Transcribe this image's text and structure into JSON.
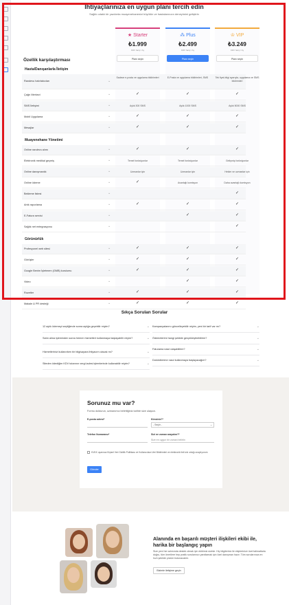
{
  "page": {
    "title": "İhtiyaçlarınıza en uygun planı tercih edin",
    "subtitle": "Sağlık odaklı bir yazılımla muayenehanenizi büyütün ve hastalarınızın deneyimini geliştirin"
  },
  "comparison": {
    "title": "Özellik karşılaştırması"
  },
  "plans": [
    {
      "name": "Starter",
      "icon": "star-icon",
      "color": "#d63f7a",
      "price": "₺1.999",
      "tag": "KDV hariç / Ay",
      "button": "Planı seçin",
      "primary": false
    },
    {
      "name": "Plus",
      "icon": "sparkle-icon",
      "color": "#3b82f6",
      "price": "₺2.499",
      "tag": "KDV hariç / Ay",
      "button": "Planı seçin",
      "primary": true
    },
    {
      "name": "VIP",
      "icon": "crown-icon",
      "color": "#f2a93b",
      "price": "₺3.249",
      "tag": "KDV hariç / Ay",
      "button": "Planı seçin",
      "primary": false
    }
  ],
  "sections": [
    {
      "title": "Hasta/Danışanlarla İletişim",
      "rows": [
        {
          "label": "Randevu hatırlatıcıları",
          "cells": [
            "Sadece e-posta ve uygulama bildirimleri",
            "E-Posta ve uygulama bildirimleri, SMS",
            "Tek fiyat-bilgi ayarıyla, uygulama ve SMS bildirimleri"
          ]
        },
        {
          "label": "Çağrı Merkezi",
          "cells": [
            "✓",
            "✓",
            "✓"
          ]
        },
        {
          "label": "SMS İletişimi",
          "cells": [
            "Aylık 300 SMS",
            "Aylık 1000 SMS",
            "Aylık 5000 SMS"
          ]
        },
        {
          "label": "Mobil Uygulama",
          "cells": [
            "✓",
            "✓",
            "✓"
          ]
        },
        {
          "label": "Mesajlar",
          "cells": [
            "✓",
            "✓",
            "✓"
          ]
        }
      ]
    },
    {
      "title": "Muayenehane Yönetimi",
      "rows": [
        {
          "label": "Online randevu alımı",
          "cells": [
            "✓",
            "✓",
            "✓"
          ]
        },
        {
          "label": "Elektronik medikal geçmiş",
          "cells": [
            "Temel fonksiyonlar",
            "Temel fonksiyonlar",
            "Gelişmiş fonksiyonlar"
          ]
        },
        {
          "label": "Online danışmanlık",
          "cells": [
            "Uzmanlar için",
            "Uzmanlar için",
            "Hekim ve uzmanlar için"
          ]
        },
        {
          "label": "Online ödeme",
          "cells": [
            "✓",
            "Avantajlı komisyon",
            "Daha avantajlı komisyon"
          ]
        },
        {
          "label": "Bekleme listesi",
          "cells": [
            "",
            "",
            "✓"
          ]
        },
        {
          "label": "Artık raporlama",
          "cells": [
            "✓",
            "✓",
            "✓"
          ]
        },
        {
          "label": "E-Fatura servisi",
          "cells": [
            "",
            "✓",
            "✓"
          ]
        },
        {
          "label": "Sağlık net entegrasyonu",
          "cells": [
            "",
            "",
            "✓"
          ]
        }
      ]
    },
    {
      "title": "Görünürlük",
      "rows": [
        {
          "label": "Profesyonel web sitesi",
          "cells": [
            "✓",
            "✓",
            "✓"
          ]
        },
        {
          "label": "Görüşler",
          "cells": [
            "✓",
            "✓",
            "✓"
          ]
        },
        {
          "label": "Google Benim İşletmem (GMB) kurulumu",
          "cells": [
            "✓",
            "✓",
            "✓"
          ]
        },
        {
          "label": "Video",
          "cells": [
            "",
            "✓",
            "✓"
          ]
        },
        {
          "label": "Rozetler",
          "cells": [
            "✓",
            "✓",
            "✓"
          ]
        },
        {
          "label": "Makale & PR desteği",
          "cells": [
            "✓",
            "✓",
            "✓"
          ]
        }
      ]
    }
  ],
  "faq": {
    "title": "Sıkça Sorulan Sorular",
    "left": [
      "12 aylık ödemeyi seçtiğimde sonra aylığa geçebilir miyim?",
      "Satın alma işleminden sonra hemen hizmetleri kullanmaya başlayabilir miyim?",
      "Hizmetlerinizi kullanırken bir bilgisayara ihtiyacım olacak mı?",
      "Siteden ödediğim KDV tutarının vergi iadesi işlemlerinde kullanabilir miyim?"
    ],
    "right": [
      "Kampanyalarımı güncelleyebilir miyim, yeni bir tarif var mı?",
      "Ödemelerimi hangi şekilde gerçekleştirebilirim?",
      "Faturama nasıl ulaşabilirim?",
      "Dokürdlerime nasıl kullanmaya başlayacağım?"
    ]
  },
  "contact": {
    "title": "Sorunuz mu var?",
    "subtitle": "Formu doldurun, uzmanımız belirttiğiniz tarihte size ulaşsın.",
    "name_label": "E-posta adresi*",
    "specialty_label": "Kimsiniz?*",
    "specialty_value": "- Seçin -",
    "phone_label": "Telefon Numaranız*",
    "time_label": "Sizi ne zaman arayalım?*",
    "time_placeholder": "Size en uygun bir zaman belirtin",
    "consent": "KVKK uyarınca Kişisel Veri Gizlilik Politikası ve Kullanıcılara Veri Bildirimleri ve elektronik ileti izin ortağı onaylıyorum",
    "send": "Gönder"
  },
  "team": {
    "title": "Alanında en başarılı müşteri ilişkileri ekibi ile, harika bir başlangıç yapın",
    "description": "Size yeni her adımında destek olmak için ekibimiz sizinle. Hiç bilgileriniz ile ekiplerinize özel talimatlarla doğru, tüm önerilere hep pratik sorularınızı yanıtlamak için özel danışman hazır. Tüm sorularınıza en hızlı şekilde çözüm bulunacaktır.",
    "button": "Bizimle iletişime geçin"
  }
}
